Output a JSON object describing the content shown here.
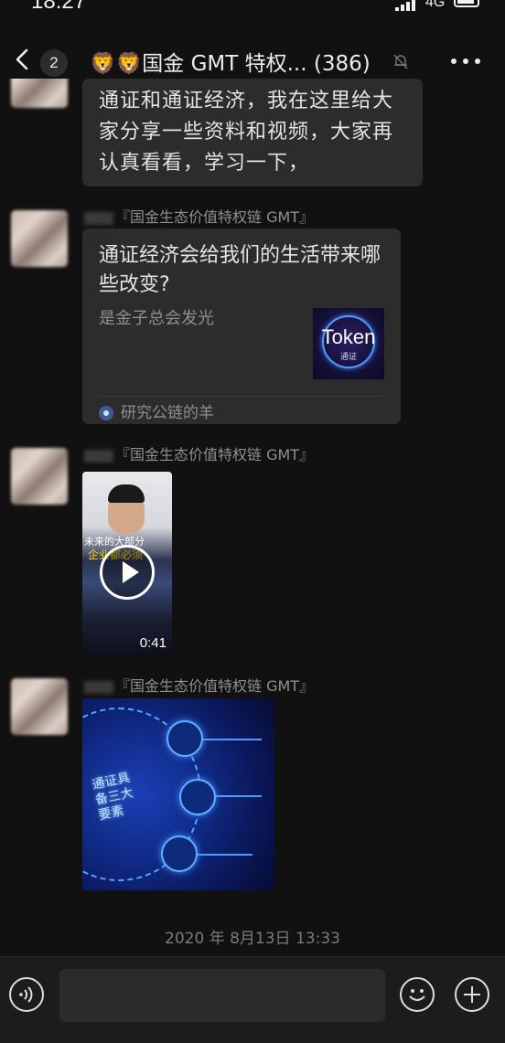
{
  "status_bar": {
    "time": "18:27",
    "network": "4G"
  },
  "header": {
    "unread_count": "2",
    "title": "🦁🦁国金 GMT 特权... (386)"
  },
  "messages": [
    {
      "type": "text",
      "text": "通证和通证经济，我在这里给大家分享一些资料和视频，大家再认真看看，学习一下，"
    },
    {
      "type": "link",
      "sender": "『国金生态价值特权链 GMT』",
      "title": "通证经济会给我们的生活带来哪些改变?",
      "description": "是金子总会发光",
      "thumb_word": "Token",
      "thumb_sub": "通证",
      "source": "研究公链的羊"
    },
    {
      "type": "video",
      "sender": "『国金生态价值特权链 GMT』",
      "caption_line1": "未来的大部分",
      "caption_line2": "企业都必须",
      "duration": "0:41"
    },
    {
      "type": "image",
      "sender": "『国金生态价值特权链 GMT』",
      "image_title": "通证具备三大要素"
    }
  ],
  "timestamp": "2020 年 8月13日 13:33",
  "input": {
    "placeholder": ""
  }
}
